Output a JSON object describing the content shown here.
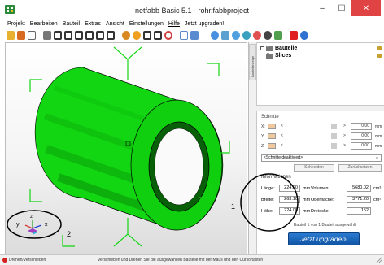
{
  "window": {
    "title": "netfabb Basic 5.1 - rohr.fabbproject",
    "minimize": "–",
    "maximize": "☐",
    "close": "✕"
  },
  "menu": [
    "Projekt",
    "Bearbeiten",
    "Bauteil",
    "Extras",
    "Ansicht",
    "Einstellungen",
    "Hilfe",
    "Jetzt upgraden!"
  ],
  "toolbar_icons": [
    "open-icon",
    "save-icon",
    "new-icon",
    "cube-view-icon",
    "cube-front-icon",
    "cube-back-icon",
    "cube-left-icon",
    "cube-right-icon",
    "cube-top-icon",
    "part-color-icon",
    "part-orange-icon",
    "part-slice-icon",
    "zoom-icon",
    "select-icon",
    "move-icon",
    "repair-icon",
    "analysis-icon",
    "measure-icon",
    "palette-icon",
    "settings-icon",
    "add-icon",
    "help-icon"
  ],
  "tree": {
    "sidebar_label": "Bauteilanzeige",
    "items": [
      "Bauteile",
      "Slices"
    ]
  },
  "cuts": {
    "title": "Schnitte",
    "rows": [
      {
        "axis": "X:",
        "lt": "<",
        "gt": ">",
        "value": "0.00",
        "unit": "mm"
      },
      {
        "axis": "Y:",
        "lt": "<",
        "gt": ">",
        "value": "0.00",
        "unit": "mm"
      },
      {
        "axis": "Z:",
        "lt": "<",
        "gt": ">",
        "value": "0.00",
        "unit": "mm"
      }
    ],
    "select": "<Schnitte deaktiviert>",
    "btn_cut": "Schneiden",
    "btn_reset": "Zurücksetzen"
  },
  "info": {
    "title": "Informationen",
    "rows": [
      {
        "k1": "Länge:",
        "v1": "224.00",
        "u1": "mm",
        "k2": "Volumen:",
        "v2": "5680.02",
        "u2": "cm³"
      },
      {
        "k1": "Breite:",
        "v1": "263.10",
        "u1": "mm",
        "k2": "Oberfläche:",
        "v2": "3771.20",
        "u2": "cm²"
      },
      {
        "k1": "Höhe:",
        "v1": "224.00",
        "u1": "mm",
        "k2": "Dreiecke:",
        "v2": "152",
        "u2": ""
      }
    ],
    "selected_note": "Bauteil 1 von 1 Bauteil ausgewählt"
  },
  "upgrade_button": "Jetzt upgraden!",
  "annotations": [
    "1",
    "2"
  ],
  "axes": {
    "x": "x",
    "y": "y",
    "z": "z"
  },
  "status": {
    "left": "Drehen/Verschieben",
    "center": "Verschieben und Drehen Sie die ausgewählten Bauteile mit der Maus und den Cursortasten"
  },
  "colors": {
    "model": "#12d612",
    "model_dark": "#0a8a0a",
    "annotation": "#000000",
    "upgrade": "#1a66c2",
    "close": "#e04343"
  }
}
